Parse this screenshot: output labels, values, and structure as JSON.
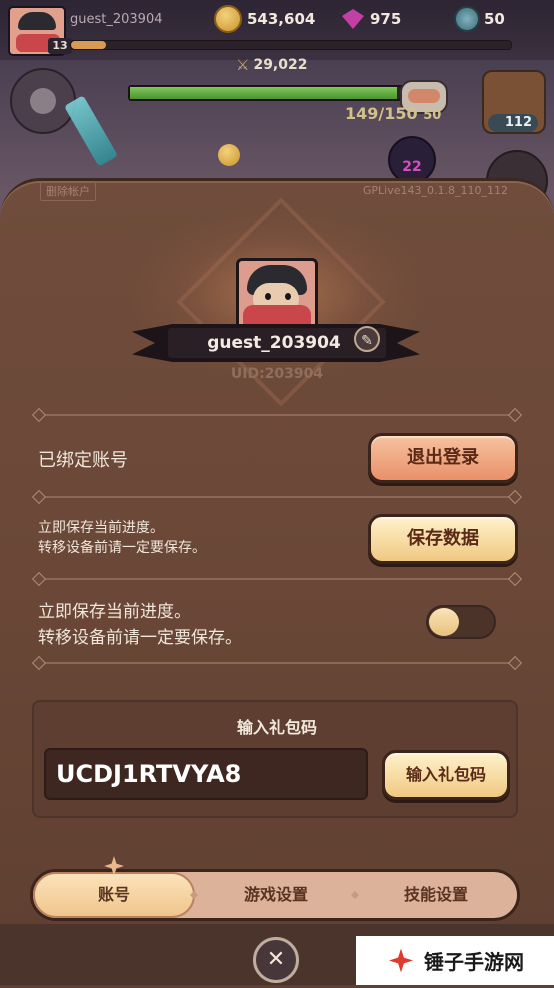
{
  "hud": {
    "player_name": "guest_203904",
    "level": "13",
    "coins": "543,604",
    "gems": "975",
    "stones": "50",
    "xp_progress": 0.08,
    "power": "29,022",
    "hp_current": "149",
    "hp_max": "/150",
    "boss_level": "50",
    "house_count": "112",
    "enemy_count": "22"
  },
  "panel": {
    "delete_account": "删除帐户",
    "version": "GPLive143_0.1.8_110_112",
    "profile": {
      "name": "guest_203904",
      "uid": "UID:203904"
    },
    "rows": [
      {
        "label": "已绑定账号",
        "button": "退出登录"
      },
      {
        "label_line1": "立即保存当前进度。",
        "label_line2": "转移设备前请一定要保存。",
        "button": "保存数据"
      },
      {
        "label_line1": "立即保存当前进度。",
        "label_line2": "转移设备前请一定要保存。",
        "toggle_on": false
      }
    ],
    "gift": {
      "title": "输入礼包码",
      "code": "UCDJ1RTVYA8",
      "button": "输入礼包码"
    },
    "tabs": [
      {
        "label": "账号",
        "active": true
      },
      {
        "label": "游戏设置",
        "active": false
      },
      {
        "label": "技能设置",
        "active": false
      }
    ],
    "close_symbol": "✕"
  },
  "watermark": {
    "text": "锤子手游网"
  },
  "colors": {
    "panel_bg": "#6a4737",
    "button_orange": "#e9916a",
    "button_cream": "#f0c981",
    "text_light": "#f0e6da"
  }
}
